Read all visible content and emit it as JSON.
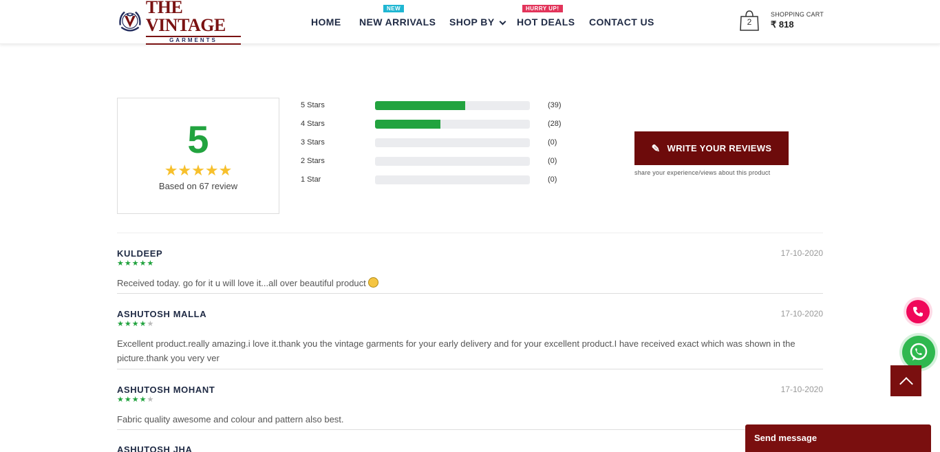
{
  "brand": {
    "name": "THE VINTAGE",
    "sub": "GARMENTS"
  },
  "nav": {
    "items": [
      {
        "label": "HOME"
      },
      {
        "label": "NEW ARRIVALS",
        "badge": "NEW"
      },
      {
        "label": "SHOP BY"
      },
      {
        "label": "HOT DEALS",
        "badge": "HURRY UP!"
      },
      {
        "label": "CONTACT US"
      }
    ]
  },
  "cart": {
    "count": "2",
    "label": "SHOPPING CART",
    "total": "₹ 818"
  },
  "rating": {
    "score": "5",
    "stars": "★★★★★",
    "based_on": "Based on 67 review",
    "breakdown": [
      {
        "label": "5 Stars",
        "count": "(39)",
        "fraction": 0.58
      },
      {
        "label": "4 Stars",
        "count": "(28)",
        "fraction": 0.42
      },
      {
        "label": "3 Stars",
        "count": "(0)",
        "fraction": 0
      },
      {
        "label": "2 Stars",
        "count": "(0)",
        "fraction": 0
      },
      {
        "label": "1 Star",
        "count": "(0)",
        "fraction": 0
      }
    ],
    "write_button": "WRITE YOUR REVIEWS",
    "write_hint": "share your experience/views about this product"
  },
  "reviews": [
    {
      "name": "KULDEEP",
      "date": "17-10-2020",
      "rating": 5,
      "text": "Received today. go for it u will love it...all over beautiful product"
    },
    {
      "name": "ASHUTOSH MALLA",
      "date": "17-10-2020",
      "rating": 4,
      "text": "Excellent product.really amazing.i love it.thank you the vintage garments for your early delivery and for your excellent product.I have received exact which was shown in the picture.thank you very ver"
    },
    {
      "name": "ASHUTOSH MOHANT",
      "date": "17-10-2020",
      "rating": 4,
      "text": "Fabric quality awesome and colour and pattern also best."
    },
    {
      "name": "ASHUTOSH JHA",
      "date": "",
      "rating": 0,
      "text": ""
    }
  ],
  "widgets": {
    "send_message": "Send message"
  },
  "colors": {
    "brand_maroon": "#6d0b0b",
    "rating_green": "#22a33f",
    "star_yellow": "#f7c02c",
    "new_badge": "#1fb6d2",
    "hot_badge": "#e2345a"
  }
}
